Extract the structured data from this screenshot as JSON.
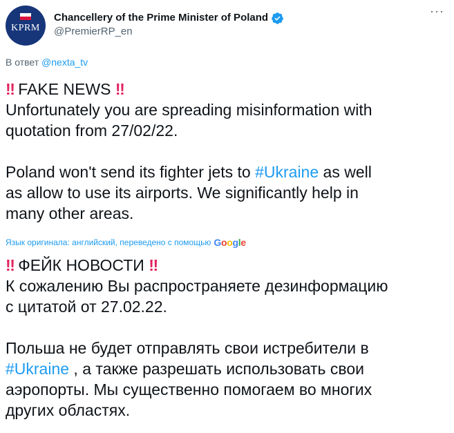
{
  "author": {
    "display_name": "Chancellery of the Prime Minister of Poland",
    "handle": "@PremierRP_en",
    "avatar_text": "KPRM",
    "verified": true
  },
  "menu": {
    "more_label": "···"
  },
  "reply": {
    "prefix": "В ответ",
    "mention": "@nexta_tv"
  },
  "tweet": {
    "line1_bang_left": "‼",
    "line1_text": " FAKE NEWS ",
    "line1_bang_right": "‼",
    "line2": "Unfortunately you are spreading misinformation with",
    "line3": "quotation from 27/02/22.",
    "para2_start": "Poland won't send its fighter jets to ",
    "para2_hashtag": "#Ukraine",
    "para2_end": " as well",
    "para2_line2": "as allow to use its airports. We significantly help in",
    "para2_line3": "many other areas."
  },
  "translation_note": {
    "text": "Язык оригинала: английский, переведено с помощью",
    "brand": [
      "G",
      "o",
      "o",
      "g",
      "l",
      "e"
    ]
  },
  "translated": {
    "line1_bang_left": "‼",
    "line1_text": " ФЕЙК НОВОСТИ ",
    "line1_bang_right": "‼",
    "line2": " К сожалению Вы распространяете дезинформацию",
    "line3": "с цитатой от 27.02.22.",
    "para2_line1": " Польша не будет отправлять свои истребители в",
    "para2_hashtag": "#Ukraine",
    "para2_line2_rest": " , а также разрешать использовать свои",
    "para2_line3": "аэропорты. Мы существенно помогаем во многих",
    "para2_line4": "других областях."
  },
  "colors": {
    "link": "#1d9bf0",
    "text": "#0f1419",
    "muted": "#536471",
    "avatar_bg": "#17367a",
    "bang": "#e0245e"
  }
}
